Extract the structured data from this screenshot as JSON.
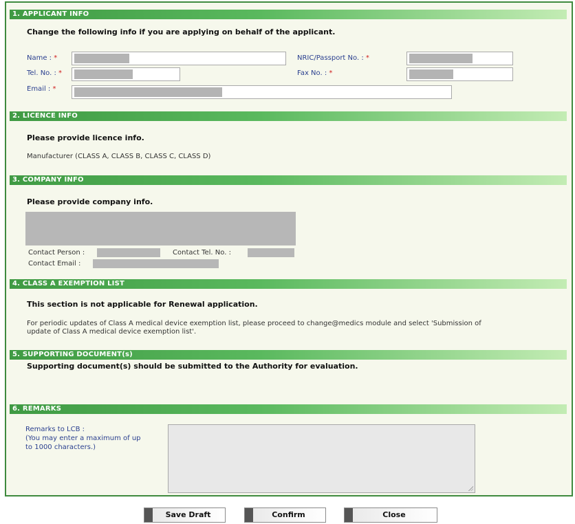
{
  "sections": {
    "applicant": {
      "title": "1. APPLICANT INFO",
      "instruction": "Change the following info if you are applying on behalf of the applicant.",
      "name_label": "Name :",
      "nric_label": "NRIC/Passport No. :",
      "tel_label": "Tel. No. :",
      "fax_label": "Fax No. :",
      "email_label": "Email :",
      "required_mark": "*"
    },
    "licence": {
      "title": "2. LICENCE INFO",
      "instruction": "Please provide licence info.",
      "licence_type": "Manufacturer (CLASS A, CLASS B, CLASS C, CLASS D)"
    },
    "company": {
      "title": "3. COMPANY INFO",
      "instruction": "Please provide company info.",
      "contact_person_label": "Contact Person :",
      "contact_tel_label": "Contact Tel. No. :",
      "contact_email_label": "Contact Email :"
    },
    "exemption": {
      "title": "4. CLASS A EXEMPTION LIST",
      "instruction": "This section is not applicable for Renewal application.",
      "note_line1": "For periodic updates of Class A medical device exemption list, please proceed to change@medics module and select 'Submission of",
      "note_line2": "update of Class A medical device exemption list'."
    },
    "supporting": {
      "title": "5. SUPPORTING DOCUMENT(s)",
      "instruction": "Supporting document(s) should be submitted to the Authority for evaluation."
    },
    "remarks": {
      "title": "6. REMARKS",
      "label_line1": "Remarks to LCB :",
      "label_line2": "(You may enter a maximum of up",
      "label_line3": "to 1000 characters.)"
    }
  },
  "buttons": {
    "save_draft": "Save Draft",
    "confirm": "Confirm",
    "close": "Close"
  },
  "colors": {
    "section_bar": "#3f9a43",
    "form_border": "#3e8a3e",
    "form_background": "#f6f8ec",
    "label_text": "#2a3f8f",
    "required_mark": "#d02020"
  }
}
